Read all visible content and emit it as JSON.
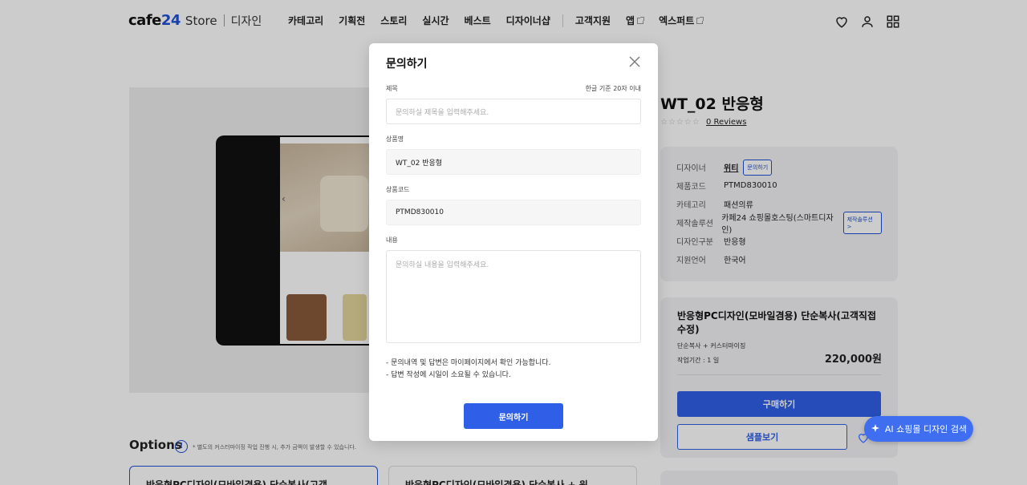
{
  "header": {
    "logo_brand": "cafe",
    "logo_num": "24",
    "logo_store": "Store",
    "logo_sub": "디자인",
    "nav": [
      "카테고리",
      "기획전",
      "스토리",
      "실시간",
      "베스트",
      "디자이너샵"
    ],
    "nav_secondary": [
      "고객지원",
      "앱",
      "엑스퍼트"
    ],
    "icons": [
      "heart-icon",
      "user-icon",
      "grid-icon"
    ]
  },
  "product": {
    "title": "WT_02 반응형",
    "stars": "☆☆☆☆☆",
    "reviews": "0 Reviews",
    "info": [
      {
        "key": "디자이너",
        "value": "위티",
        "button": "문의하기"
      },
      {
        "key": "제품코드",
        "value": "PTMD830010"
      },
      {
        "key": "카테고리",
        "value": "패션의류"
      },
      {
        "key": "제작솔루션",
        "value": "카페24 쇼핑몰호스팅(스마트디자인)",
        "button": "제작솔루션 >"
      },
      {
        "key": "디자인구분",
        "value": "반응형"
      },
      {
        "key": "지원언어",
        "value": "한국어"
      }
    ],
    "price_box": {
      "title": "반응형PC디자인(모바일겸용) 단순복사(고객직접수정)",
      "line1": "단순복사 + 커스터마이징",
      "line2": "작업기간 : 1 일",
      "price": "220,000원",
      "buy_label": "구매하기",
      "sample_label": "샘플보기"
    }
  },
  "options": {
    "title": "Options",
    "info_glyph": "!",
    "note": "* 별도의 커스터마이징 작업 진행 시, 추가 금액이 발생할 수 있습니다.",
    "cards": [
      "반응형PC디자인(모바일겸용) 단순복사(고객",
      "반응형PC디자인(모바일겸용) 단순복사 + 원"
    ]
  },
  "ai_button": {
    "label": "AI 쇼핑몰 디자인 검색",
    "icon": "sparkle-icon"
  },
  "modal": {
    "title": "문의하기",
    "subject_label": "제목",
    "subject_hint": "한글 기준 20자 이내",
    "subject_placeholder": "문의하실 제목을 입력해주세요.",
    "product_label": "상품명",
    "product_value": "WT_02 반응형",
    "code_label": "상품코드",
    "code_value": "PTMD830010",
    "content_label": "내용",
    "content_placeholder": "문의하실 내용을 입력해주세요.",
    "notice_1": "- 문의내역 및 답변은 마이페이지에서 확인 가능합니다.",
    "notice_2": "- 답변 작성에 시일이 소요될 수 있습니다.",
    "submit_label": "문의하기"
  },
  "colors": {
    "accent": "#2f5fe6",
    "overlay": "rgba(0,0,0,0.2)"
  }
}
